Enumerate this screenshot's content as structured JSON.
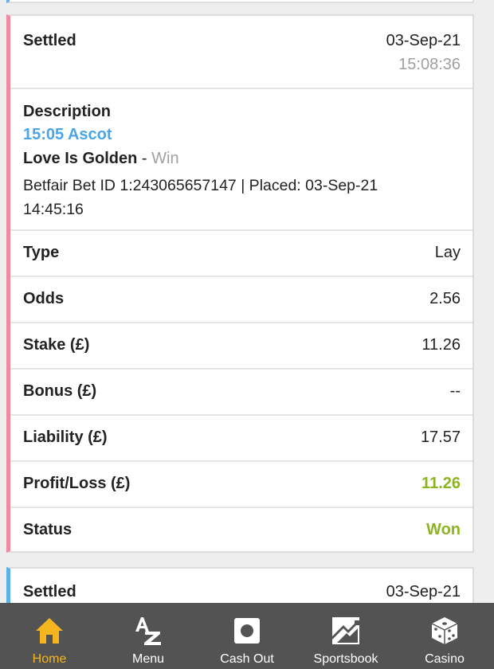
{
  "bet": {
    "status_header": "Settled",
    "settled_date": "03-Sep-21",
    "settled_time": "15:08:36",
    "description_label": "Description",
    "event": "15:05 Ascot",
    "selection": "Love Is Golden",
    "separator": " - ",
    "market": "Win",
    "bet_line": "Betfair Bet ID 1:243065657147 | Placed: 03-Sep-21 14:45:16",
    "rows": [
      {
        "label": "Type",
        "value": "Lay"
      },
      {
        "label": "Odds",
        "value": "2.56"
      },
      {
        "label": "Stake (£)",
        "value": "11.26"
      },
      {
        "label": "Bonus (£)",
        "value": "--"
      },
      {
        "label": "Liability (£)",
        "value": "17.57"
      },
      {
        "label": "Profit/Loss (£)",
        "value": "11.26"
      },
      {
        "label": "Status",
        "value": "Won"
      }
    ]
  },
  "next_bet": {
    "status_header": "Settled",
    "settled_date": "03-Sep-21"
  },
  "nav": {
    "items": [
      {
        "label": "Home",
        "icon": "home-icon",
        "active": true
      },
      {
        "label": "Menu",
        "icon": "az-icon"
      },
      {
        "label": "Cash Out",
        "icon": "cash-out-icon"
      },
      {
        "label": "Sportsbook",
        "icon": "sportsbook-icon"
      },
      {
        "label": "Casino",
        "icon": "dice-icon"
      }
    ]
  },
  "colors": {
    "accent_pink": "#ef8aa0",
    "accent_blue": "#5bb2e6",
    "win_green": "#8ab51f",
    "nav_active": "#f5b51f",
    "nav_bg": "#535353"
  }
}
